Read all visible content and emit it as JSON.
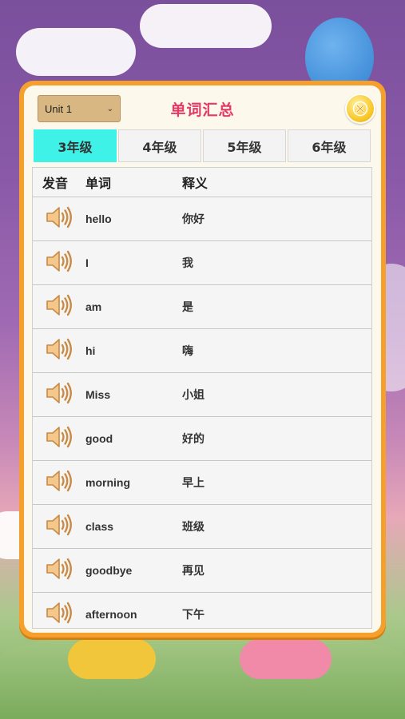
{
  "unit_select": {
    "value": "Unit 1"
  },
  "title": "单词汇总",
  "tabs": [
    {
      "label": "3年级",
      "active": true
    },
    {
      "label": "4年级",
      "active": false
    },
    {
      "label": "5年级",
      "active": false
    },
    {
      "label": "6年级",
      "active": false
    }
  ],
  "table": {
    "headers": {
      "pronounce": "发音",
      "word": "单词",
      "meaning": "释义"
    },
    "rows": [
      {
        "word": "hello",
        "meaning": "你好"
      },
      {
        "word": "I",
        "meaning": "我"
      },
      {
        "word": "am",
        "meaning": "是"
      },
      {
        "word": "hi",
        "meaning": "嗨"
      },
      {
        "word": "Miss",
        "meaning": "小姐"
      },
      {
        "word": "good",
        "meaning": "好的"
      },
      {
        "word": "morning",
        "meaning": "早上"
      },
      {
        "word": "class",
        "meaning": "班级"
      },
      {
        "word": "goodbye",
        "meaning": "再见"
      },
      {
        "word": "afternoon",
        "meaning": "下午"
      }
    ]
  },
  "icons": {
    "speaker": "speaker-icon",
    "close": "close-icon",
    "dropdown": "chevron-down-icon"
  },
  "colors": {
    "accent": "#3ef2e8",
    "title": "#e23b63",
    "frame": "#f5a02c"
  }
}
